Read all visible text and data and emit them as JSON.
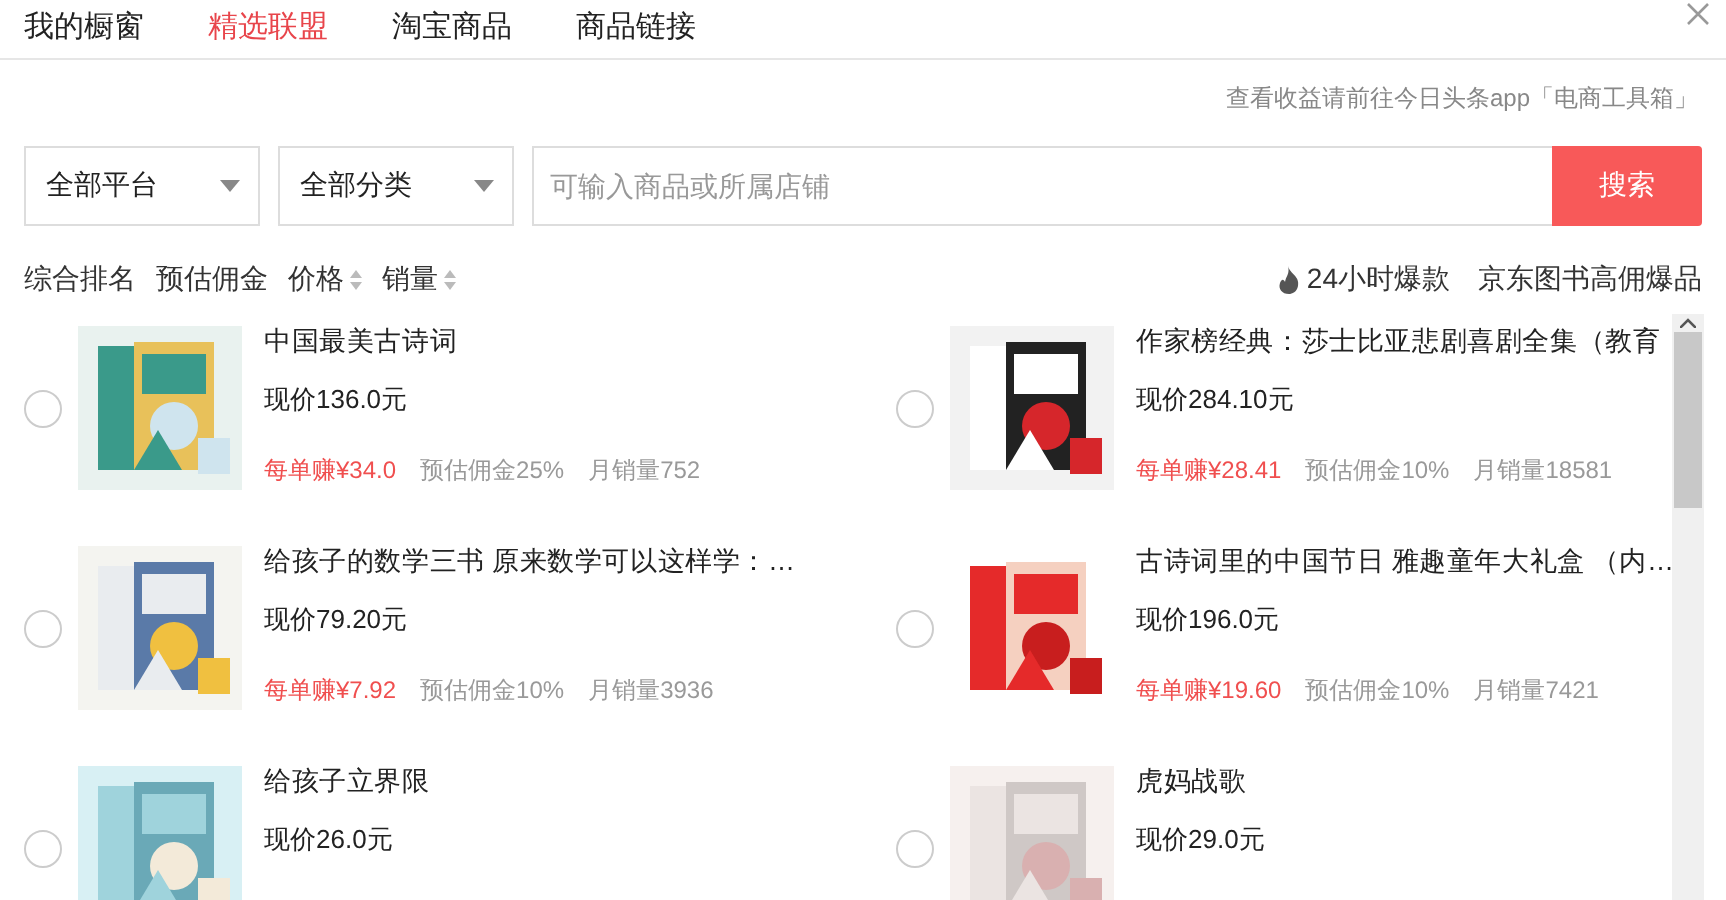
{
  "tabs": [
    {
      "label": "我的橱窗",
      "selected": false
    },
    {
      "label": "精选联盟",
      "selected": true
    },
    {
      "label": "淘宝商品",
      "selected": false
    },
    {
      "label": "商品链接",
      "selected": false
    }
  ],
  "hint": "查看收益请前往今日头条app「电商工具箱」",
  "filters": [
    {
      "value": "全部平台"
    },
    {
      "value": "全部分类"
    }
  ],
  "search": {
    "placeholder": "可输入商品或所属店铺",
    "button": "搜索"
  },
  "sort": [
    {
      "label": "综合排名",
      "sortable": false
    },
    {
      "label": "预估佣金",
      "sortable": false
    },
    {
      "label": "价格",
      "sortable": true
    },
    {
      "label": "销量",
      "sortable": true
    }
  ],
  "hot_links": [
    {
      "label": "24小时爆款",
      "kind": "fire"
    },
    {
      "label": "京东图书高佣爆品",
      "kind": "plain"
    }
  ],
  "products": [
    {
      "title": "中国最美古诗词",
      "price": "现价136.0元",
      "earn": "每单赚¥34.0",
      "commission": "预估佣金25%",
      "sales": "月销量752",
      "selected": false
    },
    {
      "title": "作家榜经典：莎士比亚悲剧喜剧全集（教育",
      "price": "现价284.10元",
      "earn": "每单赚¥28.41",
      "commission": "预估佣金10%",
      "sales": "月销量18581",
      "selected": false
    },
    {
      "title": "给孩子的数学三书 原来数学可以这样学：…",
      "price": "现价79.20元",
      "earn": "每单赚¥7.92",
      "commission": "预估佣金10%",
      "sales": "月销量3936",
      "selected": false
    },
    {
      "title": "古诗词里的中国节日 雅趣童年大礼盒 （内…",
      "price": "现价196.0元",
      "earn": "每单赚¥19.60",
      "commission": "预估佣金10%",
      "sales": "月销量7421",
      "selected": false
    },
    {
      "title": "给孩子立界限",
      "price": "现价26.0元",
      "selected": false
    },
    {
      "title": "虎妈战歌",
      "price": "现价29.0元",
      "selected": false
    }
  ]
}
